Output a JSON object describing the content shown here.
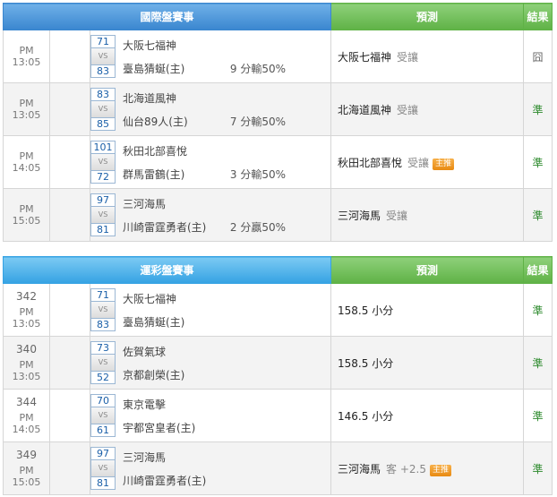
{
  "table1": {
    "header": {
      "main": "國際盤賽事",
      "prediction": "預測",
      "result": "結果"
    },
    "rows": [
      {
        "time": "PM 13:05",
        "score_a": "71",
        "score_b": "83",
        "team_a": "大阪七福神",
        "team_b": "臺島猜蜒(主)",
        "spread": "9 分輸50%",
        "pred_team": "大阪七福神",
        "pred_note": "受讓",
        "pred_tag": "",
        "result": "囧",
        "result_kind": "lose"
      },
      {
        "time": "PM 13:05",
        "score_a": "83",
        "score_b": "85",
        "team_a": "北海道風神",
        "team_b": "仙台89人(主)",
        "spread": "7 分輸50%",
        "pred_team": "北海道風神",
        "pred_note": "受讓",
        "pred_tag": "",
        "result": "準",
        "result_kind": "win"
      },
      {
        "time": "PM 14:05",
        "score_a": "101",
        "score_b": "72",
        "team_a": "秋田北部喜悅",
        "team_b": "群馬雷鶴(主)",
        "spread": "3 分輸50%",
        "pred_team": "秋田北部喜悅",
        "pred_note": "受讓",
        "pred_tag": "主推",
        "result": "準",
        "result_kind": "win"
      },
      {
        "time": "PM 15:05",
        "score_a": "97",
        "score_b": "81",
        "team_a": "三河海馬",
        "team_b": "川崎雷霆勇者(主)",
        "spread": "2 分贏50%",
        "pred_team": "三河海馬",
        "pred_note": "受讓",
        "pred_tag": "",
        "result": "準",
        "result_kind": "win"
      }
    ]
  },
  "table2": {
    "header": {
      "main": "運彩盤賽事",
      "prediction": "預測",
      "result": "結果"
    },
    "rows": [
      {
        "game_no": "342",
        "time": "PM 13:05",
        "score_a": "71",
        "score_b": "83",
        "team_a": "大阪七福神",
        "team_b": "臺島猜蜒(主)",
        "pred_team": "158.5 小分",
        "pred_note": "",
        "pred_tag": "",
        "result": "準",
        "result_kind": "win"
      },
      {
        "game_no": "340",
        "time": "PM 13:05",
        "score_a": "73",
        "score_b": "52",
        "team_a": "佐賀氣球",
        "team_b": "京都創榮(主)",
        "pred_team": "158.5 小分",
        "pred_note": "",
        "pred_tag": "",
        "result": "準",
        "result_kind": "win"
      },
      {
        "game_no": "344",
        "time": "PM 14:05",
        "score_a": "70",
        "score_b": "61",
        "team_a": "東京電擊",
        "team_b": "宇都宮皇者(主)",
        "pred_team": "146.5 小分",
        "pred_note": "",
        "pred_tag": "",
        "result": "準",
        "result_kind": "win"
      },
      {
        "game_no": "349",
        "time": "PM 15:05",
        "score_a": "97",
        "score_b": "81",
        "team_a": "三河海馬",
        "team_b": "川崎雷霆勇者(主)",
        "pred_team": "三河海馬",
        "pred_note": "客 +2.5",
        "pred_tag": "主推",
        "result": "準",
        "result_kind": "win"
      }
    ]
  },
  "vs_label": "VS",
  "colors": {
    "win": "#2e8b2e",
    "lose": "#666666",
    "tag": "#e88a12"
  }
}
